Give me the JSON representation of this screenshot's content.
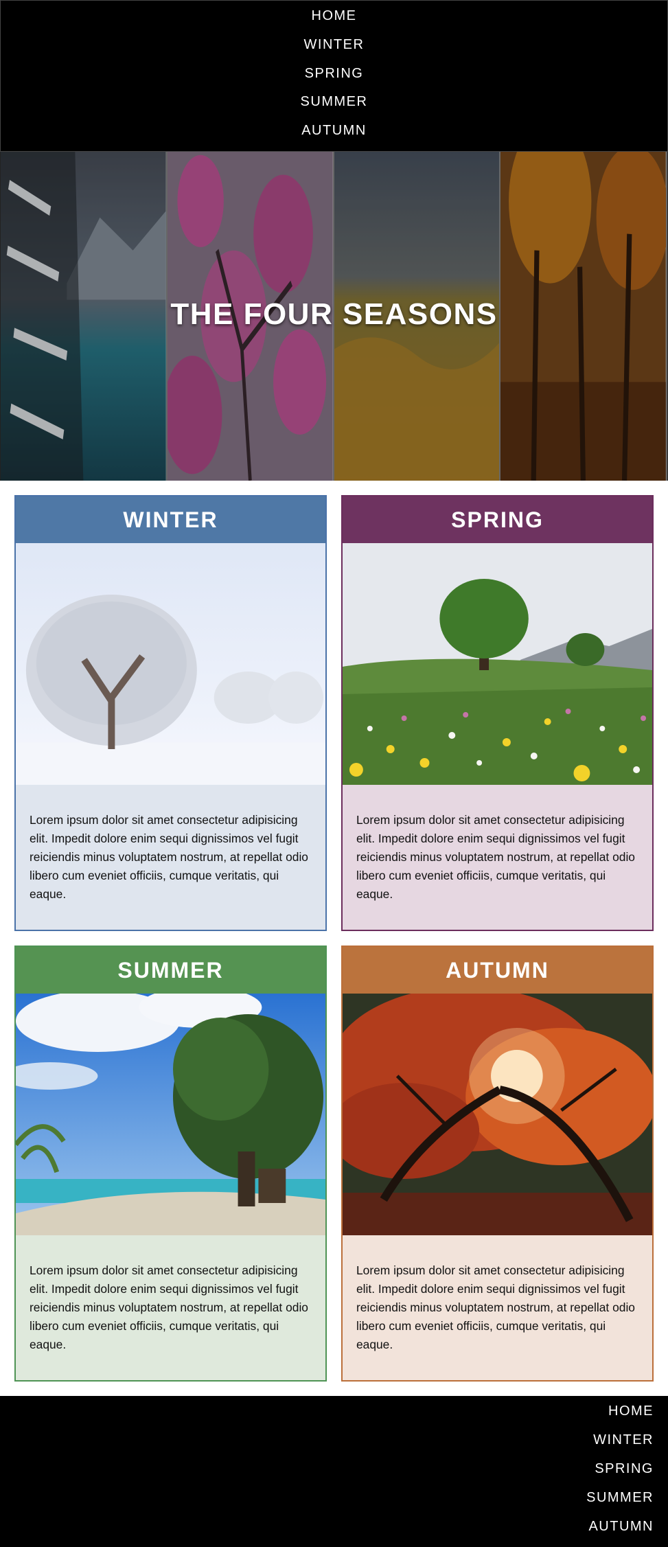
{
  "nav": {
    "items": [
      "HOME",
      "WINTER",
      "SPRING",
      "SUMMER",
      "AUTUMN"
    ]
  },
  "hero": {
    "title": "THE FOUR SEASONS"
  },
  "cards": [
    {
      "title": "WINTER",
      "text": "Lorem ipsum dolor sit amet consectetur adipisicing elit. Impedit dolore enim sequi dignissimos vel fugit reiciendis minus voluptatem nostrum, at repellat odio libero cum eveniet officiis, cumque veritatis, qui eaque.",
      "image": "snowy-tree-image"
    },
    {
      "title": "SPRING",
      "text": "Lorem ipsum dolor sit amet consectetur adipisicing elit. Impedit dolore enim sequi dignissimos vel fugit reiciendis minus voluptatem nostrum, at repellat odio libero cum eveniet officiis, cumque veritatis, qui eaque.",
      "image": "flower-meadow-tree-image"
    },
    {
      "title": "SUMMER",
      "text": "Lorem ipsum dolor sit amet consectetur adipisicing elit. Impedit dolore enim sequi dignissimos vel fugit reiciendis minus voluptatem nostrum, at repellat odio libero cum eveniet officiis, cumque veritatis, qui eaque.",
      "image": "beach-treehouse-image"
    },
    {
      "title": "AUTUMN",
      "text": "Lorem ipsum dolor sit amet consectetur adipisicing elit. Impedit dolore enim sequi dignissimos vel fugit reiciendis minus voluptatem nostrum, at repellat odio libero cum eveniet officiis, cumque veritatis, qui eaque.",
      "image": "red-autumn-tree-image"
    }
  ],
  "footer": {
    "items": [
      "HOME",
      "WINTER",
      "SPRING",
      "SUMMER",
      "AUTUMN"
    ]
  },
  "colors": {
    "winter": "#4f78a6",
    "spring": "#6e3360",
    "summer": "#559352",
    "autumn": "#bb733d",
    "nav_bg": "#000000"
  }
}
